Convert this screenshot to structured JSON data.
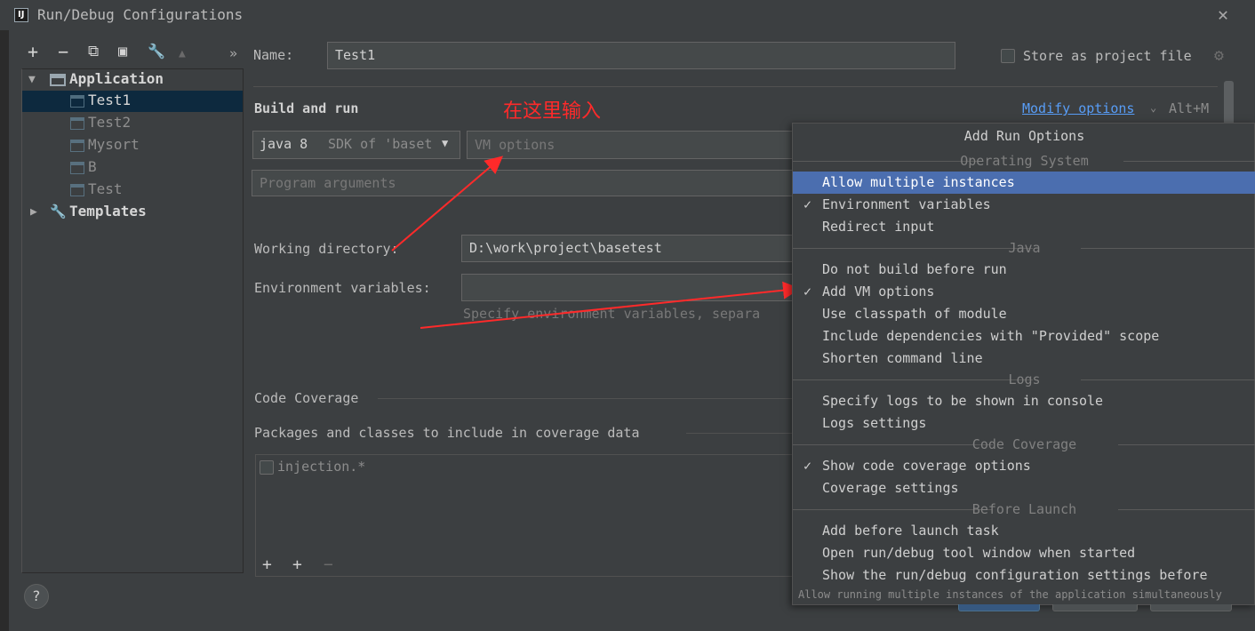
{
  "window": {
    "title": "Run/Debug Configurations",
    "close_glyph": "✕"
  },
  "toolbar": {
    "items": [
      {
        "icon": "add-icon",
        "glyph": "+"
      },
      {
        "icon": "remove-icon",
        "glyph": "−"
      },
      {
        "icon": "copy-icon",
        "glyph": "⧉"
      },
      {
        "icon": "save-icon",
        "glyph": "▣"
      },
      {
        "icon": "wrench-icon",
        "glyph": "🔧"
      },
      {
        "icon": "move-up-icon",
        "glyph": "▲"
      },
      {
        "icon": "more-icon",
        "glyph": "»"
      }
    ]
  },
  "tree": {
    "application": "Application",
    "items": [
      "Test1",
      "Test2",
      "Mysort",
      "B",
      "Test"
    ],
    "selected": "Test1",
    "templates": "Templates"
  },
  "form": {
    "name_label": "Name:",
    "name_value": "Test1",
    "store_label": "Store as project file",
    "section_build": "Build and run",
    "modify_options": "Modify options",
    "modify_shortcut": "Alt+M",
    "sdk_java": "java 8",
    "sdk_desc": "SDK of 'basetest'",
    "vm_placeholder": "VM options",
    "program_placeholder": "Program arguments",
    "workdir_label": "Working directory:",
    "workdir_value": "D:\\work\\project\\basetest",
    "env_label": "Environment variables:",
    "env_hint": "Specify environment variables, separa",
    "code_coverage": "Code Coverage",
    "packages_label": "Packages and classes to include in coverage data",
    "coverage_pattern": "injection.*"
  },
  "annotation": {
    "text": "在这里输入",
    "color": "#ff2a2a"
  },
  "popup": {
    "title": "Add Run Options",
    "sections": [
      {
        "label": "Operating System",
        "items": [
          {
            "label": "Allow multiple instances",
            "checked": false,
            "highlighted": true
          },
          {
            "label": "Environment variables",
            "checked": true
          },
          {
            "label": "Redirect input",
            "checked": false
          }
        ]
      },
      {
        "label": "Java",
        "items": [
          {
            "label": "Do not build before run",
            "checked": false
          },
          {
            "label": "Add VM options",
            "checked": true
          },
          {
            "label": "Use classpath of module",
            "checked": false
          },
          {
            "label": "Include dependencies with \"Provided\" scope",
            "checked": false
          },
          {
            "label": "Shorten command line",
            "checked": false
          }
        ]
      },
      {
        "label": "Logs",
        "items": [
          {
            "label": "Specify logs to be shown in console",
            "checked": false
          },
          {
            "label": "Logs settings",
            "checked": false
          }
        ]
      },
      {
        "label": "Code Coverage",
        "items": [
          {
            "label": "Show code coverage options",
            "checked": true
          },
          {
            "label": "Coverage settings",
            "checked": false
          }
        ]
      },
      {
        "label": "Before Launch",
        "items": [
          {
            "label": "Add before launch task",
            "checked": false
          },
          {
            "label": "Open run/debug tool window when started",
            "checked": false
          },
          {
            "label": "Show the run/debug configuration settings before",
            "checked": false
          }
        ]
      }
    ],
    "hint": "Allow running multiple instances of the application simultaneously"
  },
  "help": "?",
  "colors": {
    "accent": "#4b6eaf",
    "link": "#589df6",
    "selection": "#0d293e"
  }
}
